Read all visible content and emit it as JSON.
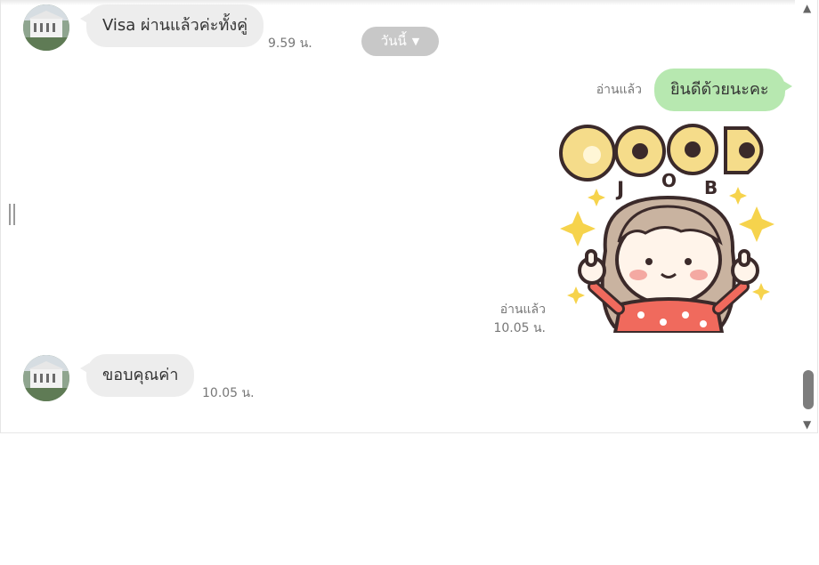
{
  "messages": [
    {
      "id": "m1",
      "direction": "incoming",
      "text": "Visa ผ่านแล้วค่ะทั้งคู่",
      "time": "9.59 น."
    },
    {
      "id": "m2",
      "direction": "outgoing",
      "text": "ยินดีด้วยนะคะ",
      "status": "อ่านแล้ว"
    },
    {
      "id": "m3",
      "direction": "outgoing",
      "type": "sticker",
      "sticker_text": "GOOD JOB",
      "status": "อ่านแล้ว",
      "time": "10.05 น."
    },
    {
      "id": "m4",
      "direction": "incoming",
      "text": "ขอบคุณค่า",
      "time": "10.05 น."
    }
  ],
  "date_divider": {
    "label": "วันนี้",
    "icon": "caret-down-icon"
  },
  "icons": {
    "avatar": "building-avatar-icon",
    "handle": "resize-handle-icon",
    "scroll_up": "arrow-up-icon",
    "scroll_down": "arrow-down-icon"
  },
  "colors": {
    "incoming_bubble": "#ededed",
    "outgoing_bubble": "#b7e8b0",
    "date_pill": "#c8c8c8",
    "meta_text": "#777777"
  }
}
